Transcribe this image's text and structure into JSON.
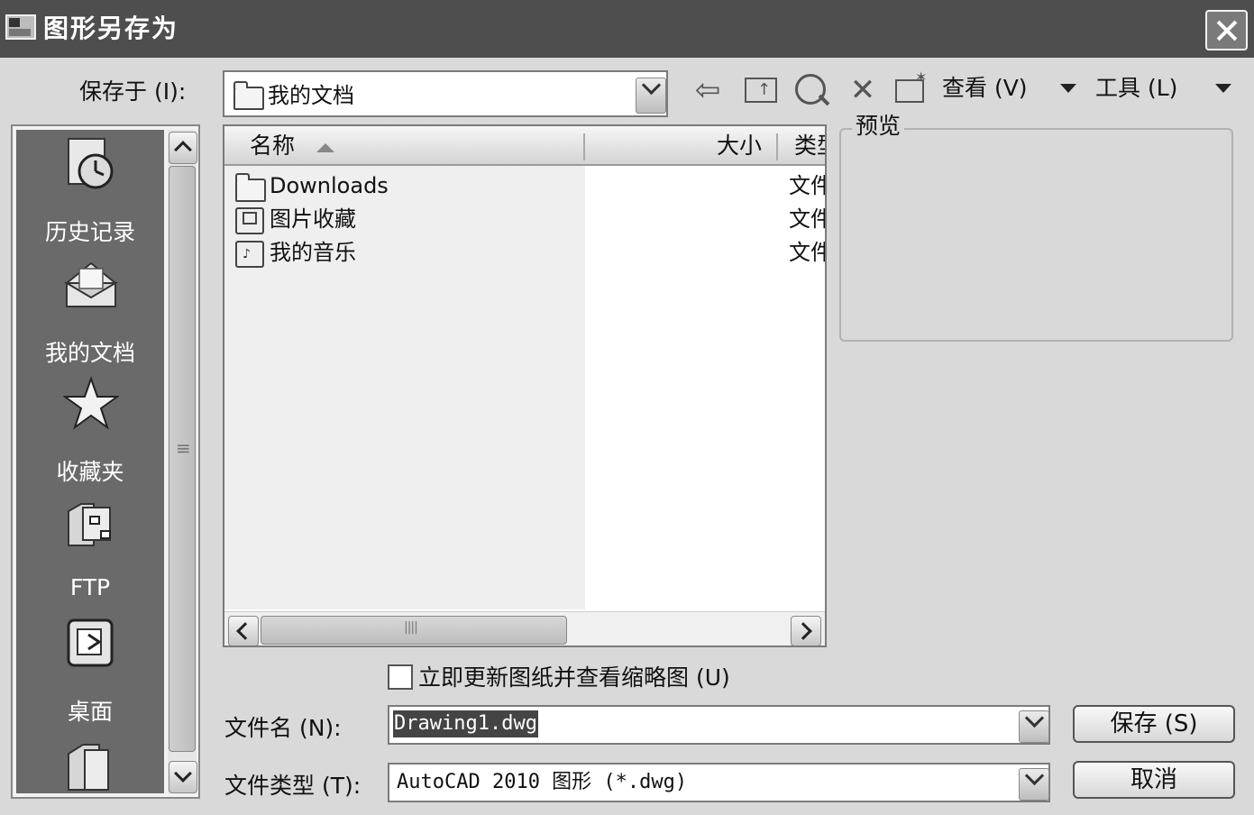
{
  "window": {
    "title": "图形另存为",
    "close_label": "×"
  },
  "save_in": {
    "label": "保存于 (I):",
    "value": "我的文档"
  },
  "toolbar": {
    "view_label": "查看 (V)",
    "tools_label": "工具 (L)"
  },
  "places": [
    {
      "label": "历史记录",
      "icon": "history-icon"
    },
    {
      "label": "我的文档",
      "icon": "my-documents-icon"
    },
    {
      "label": "收藏夹",
      "icon": "favorites-star-icon"
    },
    {
      "label": "FTP",
      "icon": "ftp-icon"
    },
    {
      "label": "桌面",
      "icon": "desktop-icon"
    }
  ],
  "file_list": {
    "columns": {
      "name": "名称",
      "size": "大小",
      "type": "类型"
    },
    "rows": [
      {
        "name": "Downloads",
        "type": "文件夹",
        "icon": "folder-icon"
      },
      {
        "name": "图片收藏",
        "type": "文件夹",
        "icon": "pictures-folder-icon"
      },
      {
        "name": "我的音乐",
        "type": "文件夹",
        "icon": "music-folder-icon"
      }
    ]
  },
  "preview": {
    "label": "预览"
  },
  "update_thumbnail": {
    "label": "立即更新图纸并查看缩略图 (U)",
    "checked": false
  },
  "filename": {
    "label": "文件名 (N):",
    "value": "Drawing1.dwg"
  },
  "filetype": {
    "label": "文件类型 (T):",
    "value": "AutoCAD 2010 图形 (*.dwg)"
  },
  "buttons": {
    "save": "保存 (S)",
    "cancel": "取消"
  }
}
